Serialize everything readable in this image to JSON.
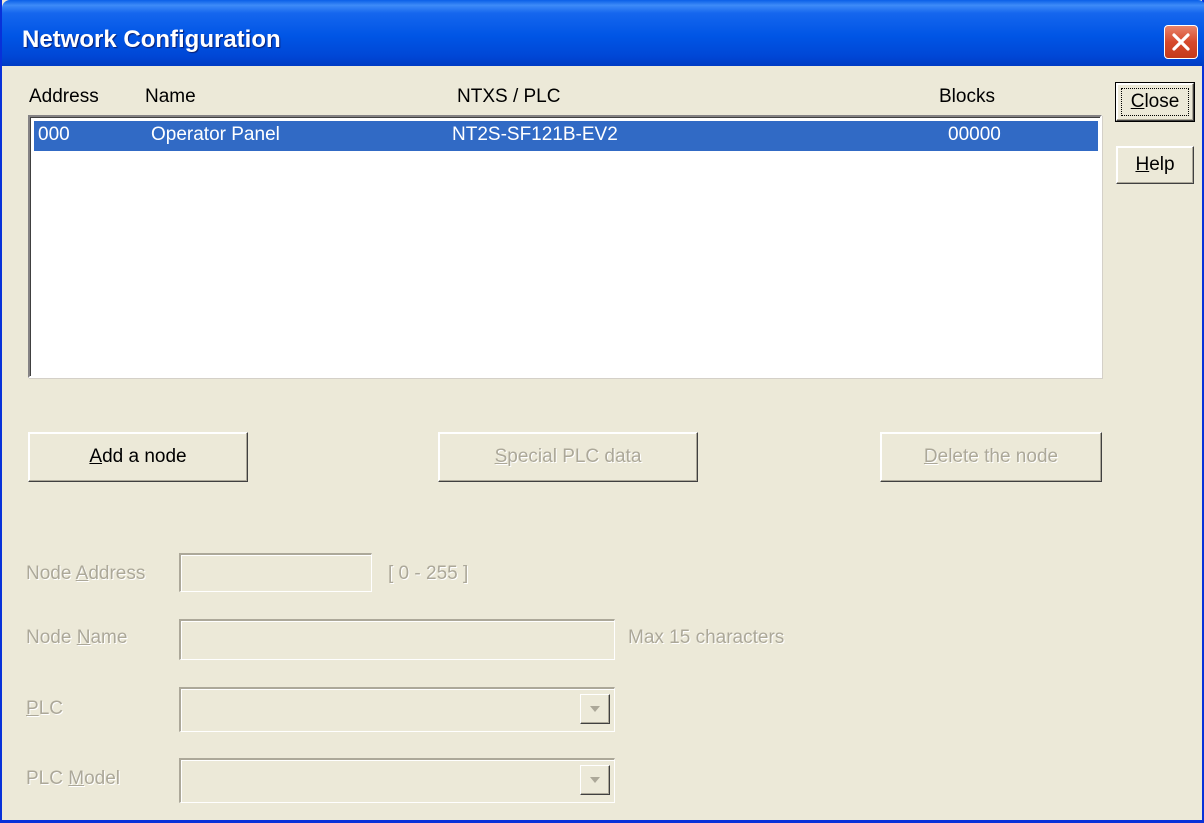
{
  "window": {
    "title": "Network Configuration"
  },
  "list": {
    "columns": [
      "Address",
      "Name",
      "NTXS / PLC",
      "Blocks"
    ],
    "rows": [
      {
        "address": "000",
        "name": "Operator Panel",
        "ntxs_plc": "NT2S-SF121B-EV2",
        "blocks": "00000",
        "selected": true
      }
    ]
  },
  "side_buttons": {
    "close": {
      "pre": "",
      "mnemonic": "C",
      "post": "lose"
    },
    "help": {
      "pre": "",
      "mnemonic": "H",
      "post": "elp"
    }
  },
  "actions": {
    "add": {
      "pre": "",
      "mnemonic": "A",
      "post": "dd a node",
      "enabled": true
    },
    "special": {
      "pre": "",
      "mnemonic": "S",
      "post": "pecial PLC data",
      "enabled": false
    },
    "delete": {
      "pre": "",
      "mnemonic": "D",
      "post": "elete the node",
      "enabled": false
    }
  },
  "form": {
    "node_address": {
      "pre": "Node ",
      "mnemonic": "A",
      "post": "ddress",
      "value": "",
      "hint": "[ 0 - 255 ]"
    },
    "node_name": {
      "pre": "Node ",
      "mnemonic": "N",
      "post": "ame",
      "value": "",
      "hint": "Max 15 characters"
    },
    "plc": {
      "pre": "",
      "mnemonic": "P",
      "post": "LC",
      "value": ""
    },
    "plc_model": {
      "pre": "PLC ",
      "mnemonic": "M",
      "post": "odel",
      "value": ""
    }
  },
  "icons": {
    "close": "close-x-icon",
    "dropdown": "chevron-down-icon"
  },
  "colors": {
    "titlebar": "#0055e5",
    "selection": "#316ac5",
    "face": "#ece9d8",
    "disabled_text": "#aca899"
  }
}
